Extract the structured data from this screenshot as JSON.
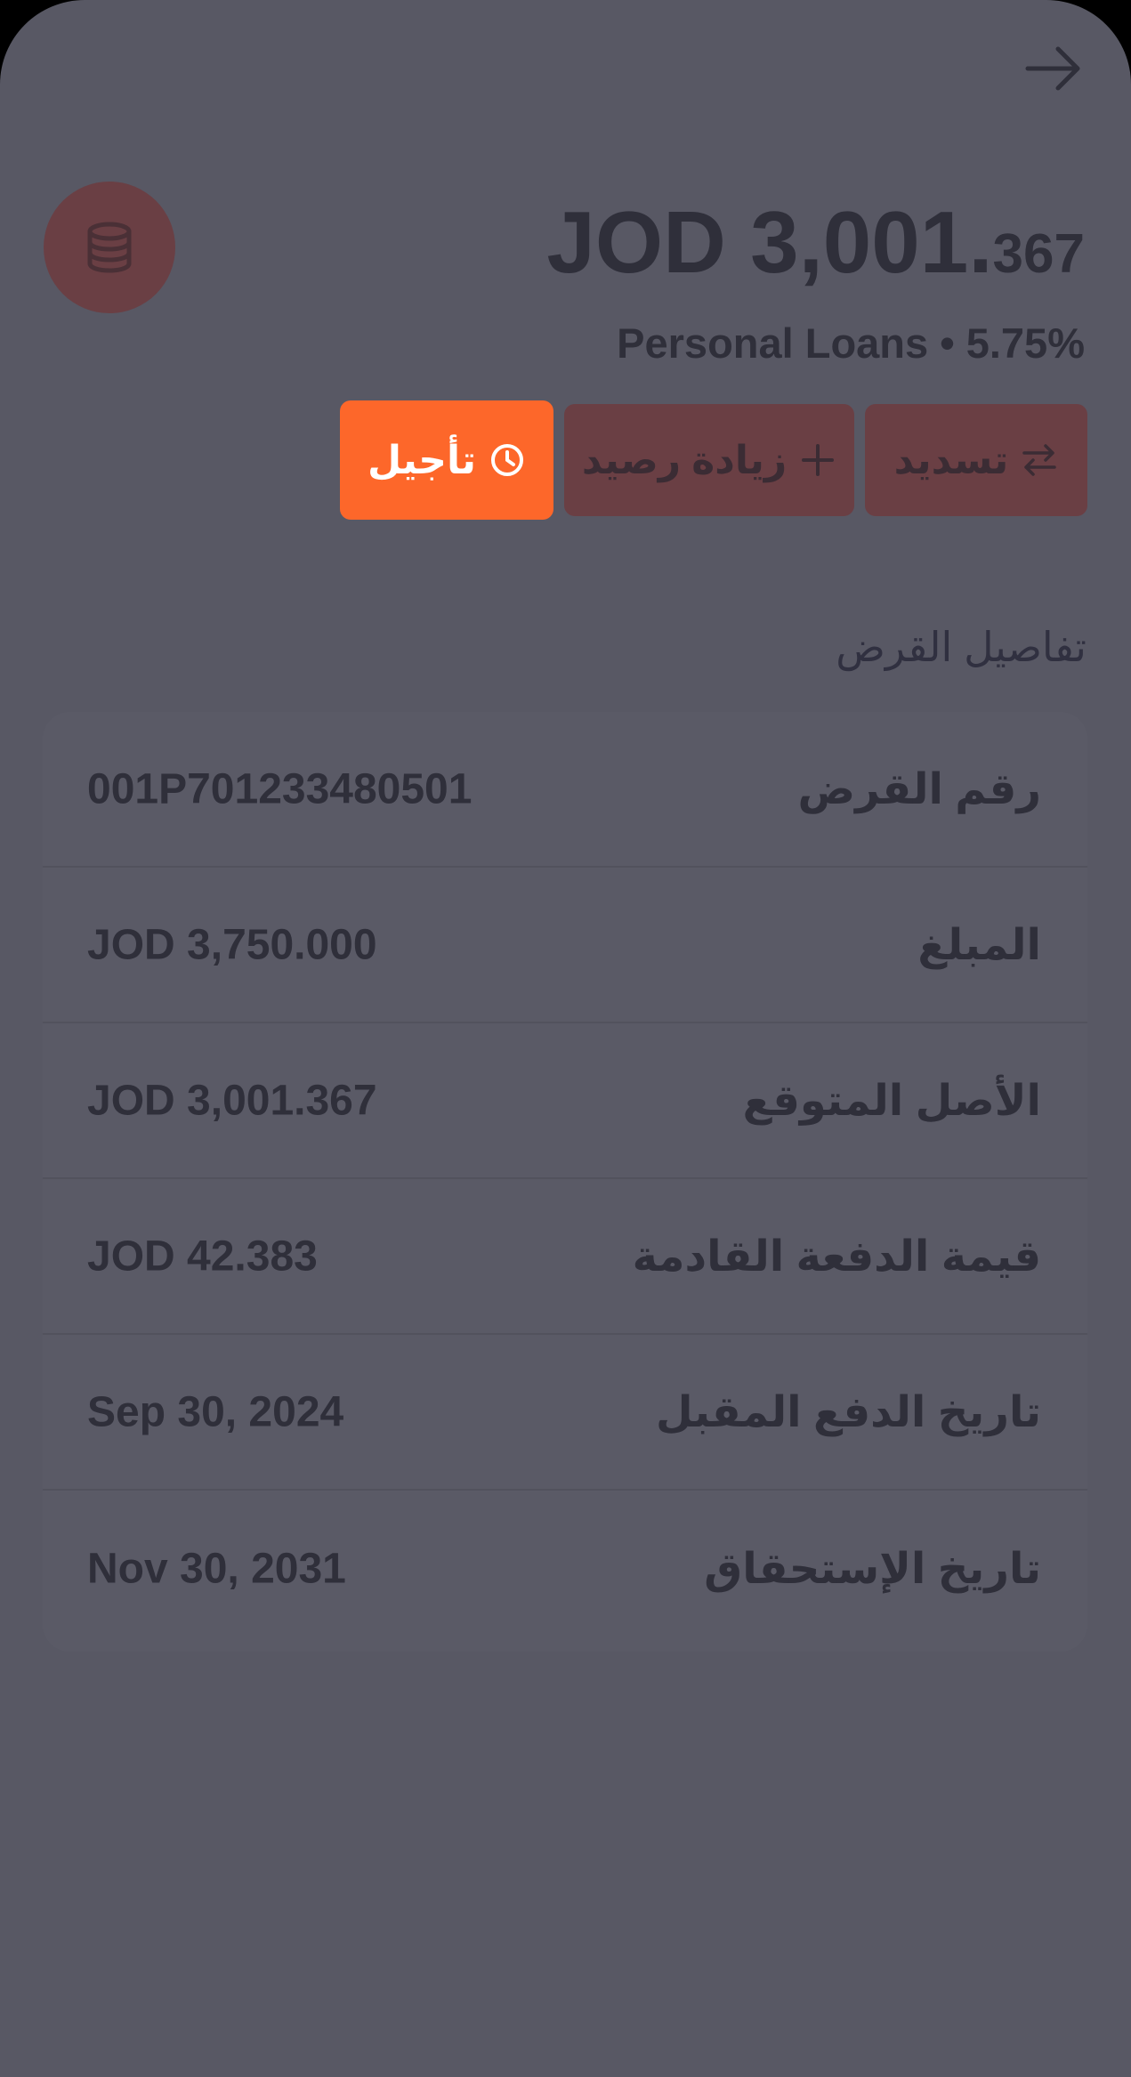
{
  "header": {
    "back_icon": "arrow-right-icon"
  },
  "summary": {
    "icon": "coins-stack-icon",
    "balance_main": "JOD 3,001.",
    "balance_fraction": "367",
    "subtitle": "Personal Loans • 5.75%"
  },
  "actions": {
    "defer_label": "تأجيل",
    "defer_icon": "clock-icon",
    "topup_label": "زيادة رصيد",
    "topup_icon": "plus-icon",
    "repay_label": "تسديد",
    "repay_icon": "swap-arrows-icon"
  },
  "details": {
    "title": "تفاصيل القرض",
    "rows": [
      {
        "label": "رقم القرض",
        "value": "001P701233480501"
      },
      {
        "label": "المبلغ",
        "value": "JOD 3,750.000"
      },
      {
        "label": "الأصل المتوقع",
        "value": "JOD 3,001.367"
      },
      {
        "label": "قيمة الدفعة القادمة",
        "value": "JOD 42.383"
      },
      {
        "label": "تاريخ الدفع المقبل",
        "value": "Sep 30, 2024"
      },
      {
        "label": "تاريخ الإستحقاق",
        "value": "Nov 30, 2031"
      }
    ]
  },
  "colors": {
    "background": "#585864",
    "accent": "#fd672a",
    "muted_button": "#6a3f44",
    "text": "#2f2f3a"
  }
}
